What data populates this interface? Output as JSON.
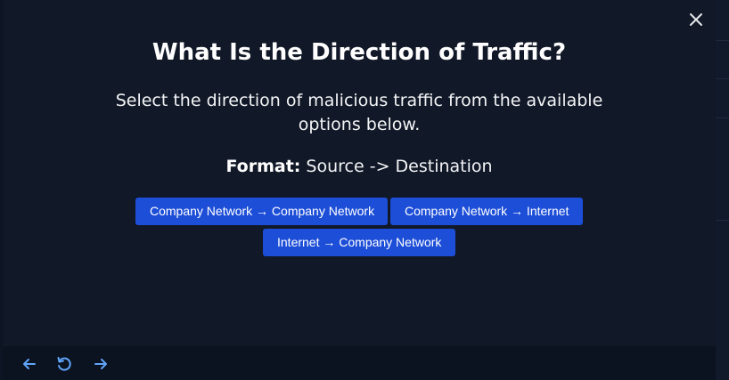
{
  "modal": {
    "title": "What Is the Direction of Traffic?",
    "subtitle": "Select the direction of malicious traffic from the available options below.",
    "format_label": "Format:",
    "format_value": " Source -> Destination",
    "options": [
      {
        "label": "Company Network → Company Network"
      },
      {
        "label": "Company Network → Internet"
      },
      {
        "label": "Internet → Company Network"
      }
    ]
  },
  "icons": {
    "close": "close-icon",
    "back": "arrow-left-icon",
    "reload": "reload-icon",
    "forward": "arrow-right-icon"
  },
  "colors": {
    "modal_background": "#111827",
    "button_background": "#1d4ed8",
    "text": "#ffffff"
  }
}
